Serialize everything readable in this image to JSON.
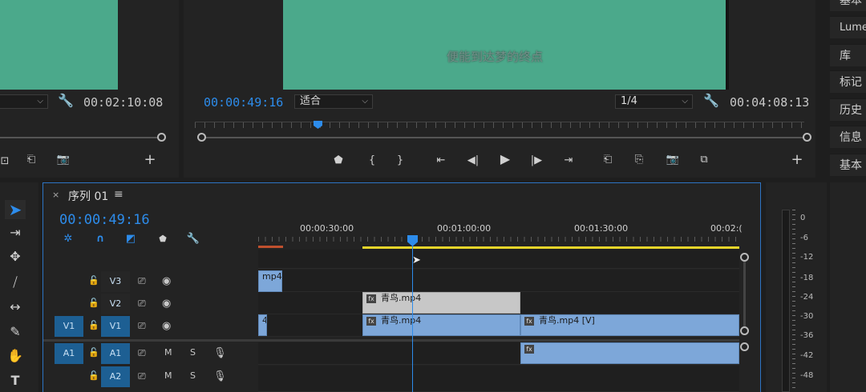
{
  "source_monitor": {
    "timecode": "00:02:10:08"
  },
  "program_monitor": {
    "subtitle": "便能到达梦的终点",
    "current_time": "00:00:49:16",
    "fit": "适合",
    "resolution": "1/4",
    "duration": "00:04:08:13"
  },
  "right_panel": {
    "items": [
      "基本",
      "Lume",
      "库",
      "标记",
      "历史",
      "信息",
      "基本"
    ]
  },
  "timeline": {
    "tab_close": "×",
    "title": "序列 01",
    "menu": "≡",
    "timecode": "00:00:49:16",
    "ruler": [
      "00:00:30:00",
      "00:01:00:00",
      "00:01:30:00",
      "00:02:("
    ],
    "tracks": [
      {
        "target": "",
        "name": "V3"
      },
      {
        "target": "",
        "name": "V2"
      },
      {
        "target": "V1",
        "name": "V1"
      },
      {
        "target": "A1",
        "name": "A1",
        "m": "M",
        "s": "S"
      },
      {
        "target": "",
        "name": "A2",
        "m": "M",
        "s": "S"
      }
    ],
    "clips": {
      "v3_a": "mp4",
      "v2_a": "青鸟.mp4",
      "v1_a": "4",
      "v1_b": "青鸟.mp4",
      "v1_c": "青鸟.mp4 [V]",
      "fx": "fx"
    }
  },
  "meter": {
    "labels": [
      "0",
      "-6",
      "-12",
      "-18",
      "-24",
      "-30",
      "-36",
      "-42",
      "-48"
    ]
  },
  "colors": {
    "accent": "#2d8ceb",
    "screen": "#4ba98b",
    "clip": "#7da7d9",
    "work_area": "#e6d52a"
  }
}
